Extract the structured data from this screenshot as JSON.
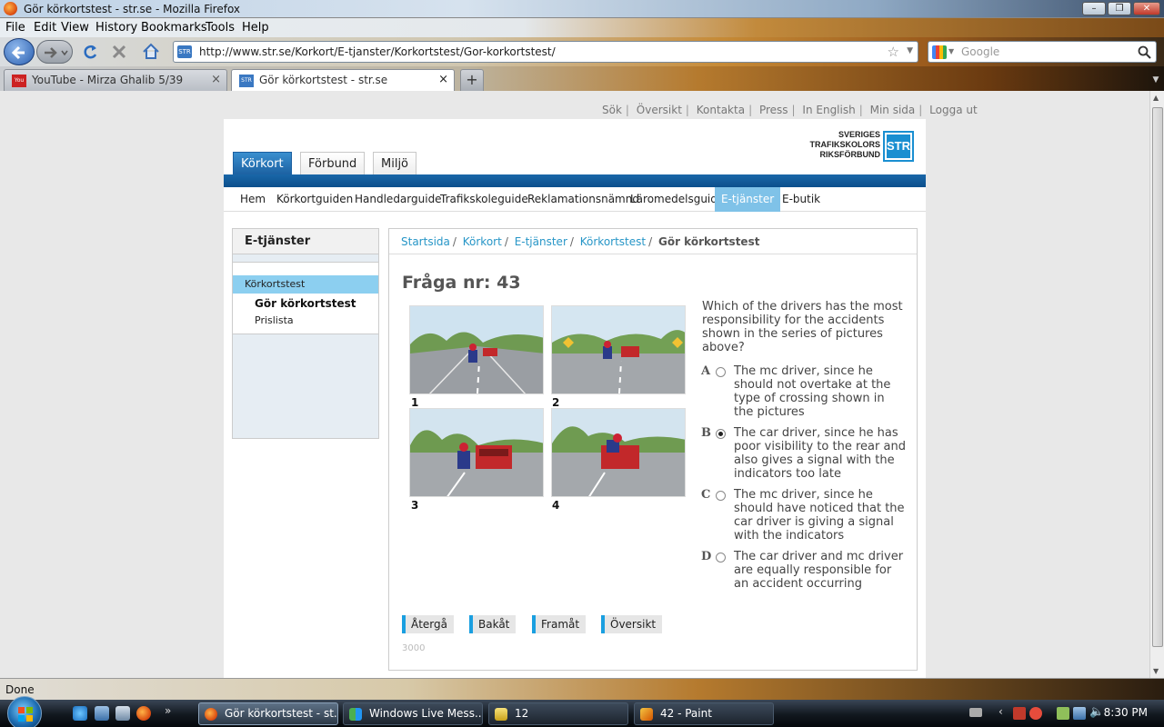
{
  "window": {
    "title": "Gör körkortstest - str.se - Mozilla Firefox"
  },
  "menubar": [
    "File",
    "Edit",
    "View",
    "History",
    "Bookmarks",
    "Tools",
    "Help"
  ],
  "navbar": {
    "url": "http://www.str.se/Korkort/E-tjanster/Korkortstest/Gor-korkortstest/",
    "search_placeholder": "Google"
  },
  "tabs": [
    {
      "label": "YouTube - Mirza Ghalib 5/39",
      "active": false
    },
    {
      "label": "Gör körkortstest - str.se",
      "active": true
    }
  ],
  "page": {
    "toplinks": [
      "Sök",
      "Översikt",
      "Kontakta",
      "Press",
      "In English",
      "Min sida",
      "Logga ut"
    ],
    "logo": {
      "line1": "SVERIGES",
      "line2": "TRAFIKSKOLORS",
      "line3": "RIKSFÖRBUND",
      "mark": "STR"
    },
    "maintabs": [
      "Körkort",
      "Förbund",
      "Miljö"
    ],
    "subnav": [
      "Hem",
      "Körkortguiden",
      "Handledarguide",
      "Trafikskoleguide",
      "Reklamationsnämnd",
      "Läromedelsguide",
      "E-tjänster",
      "E-butik"
    ],
    "sidebar": {
      "title": "E-tjänster",
      "selected": "Körkortstest",
      "sub1": "Gör körkortstest",
      "sub2": "Prislista"
    },
    "breadcrumb": [
      "Startsida",
      "Körkort",
      "E-tjänster",
      "Körkortstest",
      "Gör körkortstest"
    ],
    "question_title": "Fråga nr: 43",
    "picture_numbers": [
      "1",
      "2",
      "3",
      "4"
    ],
    "question": "Which of the drivers has the most responsibility for the accidents shown in the series of pictures above?",
    "answers": [
      {
        "letter": "A",
        "text": "The mc driver, since he should not overtake at the type of crossing shown in the pictures",
        "selected": false
      },
      {
        "letter": "B",
        "text": "The car driver, since he has poor visibility to the rear and also gives a signal with the indicators too late",
        "selected": true
      },
      {
        "letter": "C",
        "text": "The mc driver, since he should have noticed that the car driver is giving a signal with the indicators",
        "selected": false
      },
      {
        "letter": "D",
        "text": "The car driver and mc driver are equally responsible for an accident occurring",
        "selected": false
      }
    ],
    "buttons": [
      "Återgå",
      "Bakåt",
      "Framåt",
      "Översikt"
    ],
    "code": "3000"
  },
  "statusbar": {
    "text": "Done"
  },
  "taskbar": {
    "items": [
      "Gör körkortstest - st...",
      "Windows Live Mess...",
      "12",
      "42 - Paint"
    ],
    "clock": "8:30 PM"
  },
  "colors": {
    "accent": "#1a9fe0",
    "brand_blue": "#0b4f8c",
    "link": "#2796c7",
    "selected_nav": "#7fc2e8"
  }
}
